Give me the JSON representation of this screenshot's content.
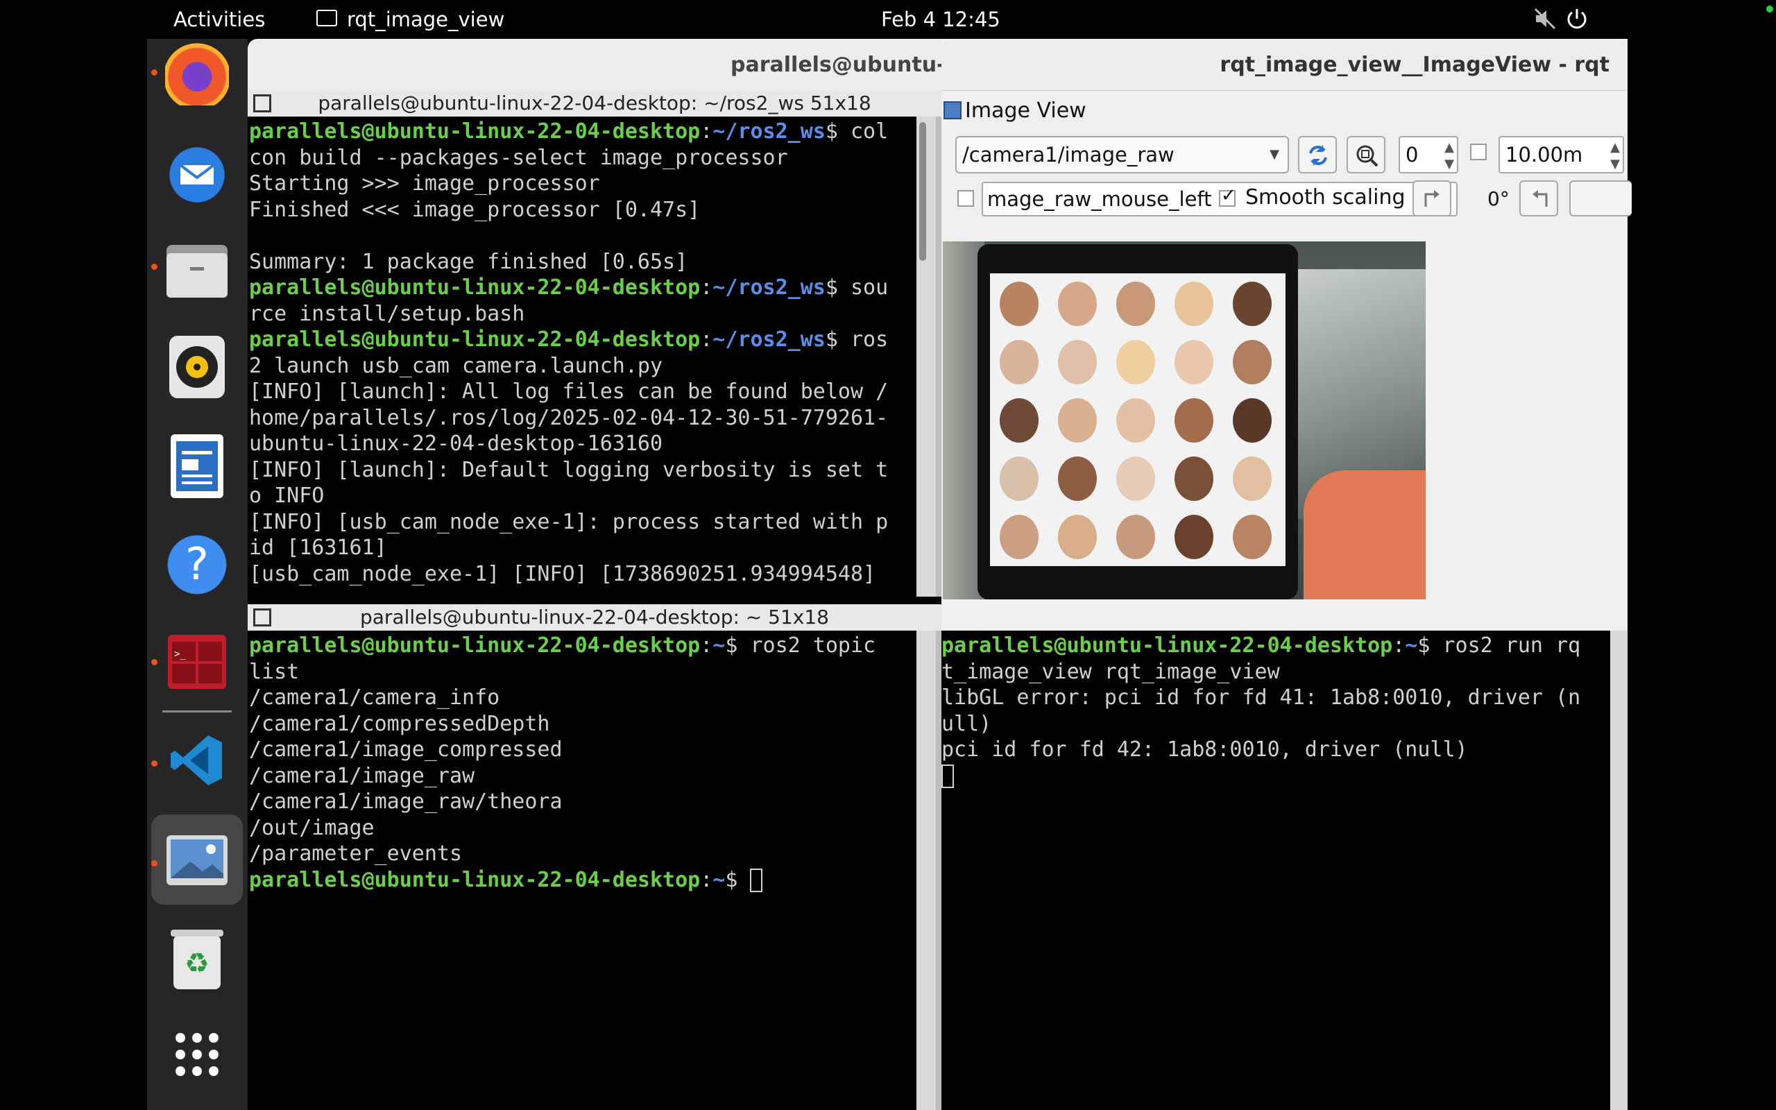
{
  "topbar": {
    "activities": "Activities",
    "app_name": "rqt_image_view",
    "clock": "Feb 4  12:45"
  },
  "dock": {
    "items": [
      "firefox-icon",
      "thunderbird-icon",
      "files-icon",
      "rhythmbox-icon",
      "writer-icon",
      "help-icon",
      "terminal-icon",
      "vscode-icon",
      "image-viewer-icon",
      "trash-icon",
      "show-apps-icon"
    ]
  },
  "terminal_window": {
    "title": "parallels@ubuntu-li"
  },
  "terminal_top": {
    "tab_title": "parallels@ubuntu-linux-22-04-desktop: ~/ros2_ws 51x18",
    "lines": [
      {
        "user": "parallels@ubuntu-linux-22-04-desktop",
        "path": "~/ros2_ws",
        "text": "$ col"
      },
      {
        "text": "con build --packages-select image_processor"
      },
      {
        "text": "Starting >>> image_processor"
      },
      {
        "text": "Finished <<< image_processor [0.47s]"
      },
      {
        "text": ""
      },
      {
        "text": "Summary: 1 package finished [0.65s]"
      },
      {
        "user": "parallels@ubuntu-linux-22-04-desktop",
        "path": "~/ros2_ws",
        "text": "$ sou"
      },
      {
        "text": "rce install/setup.bash"
      },
      {
        "user": "parallels@ubuntu-linux-22-04-desktop",
        "path": "~/ros2_ws",
        "text": "$ ros"
      },
      {
        "text": "2 launch usb_cam camera.launch.py"
      },
      {
        "text": "[INFO] [launch]: All log files can be found below /"
      },
      {
        "text": "home/parallels/.ros/log/2025-02-04-12-30-51-779261-"
      },
      {
        "text": "ubuntu-linux-22-04-desktop-163160"
      },
      {
        "text": "[INFO] [launch]: Default logging verbosity is set t"
      },
      {
        "text": "o INFO"
      },
      {
        "text": "[INFO] [usb_cam_node_exe-1]: process started with p"
      },
      {
        "text": "id [163161]"
      },
      {
        "text": "[usb_cam_node_exe-1] [INFO] [1738690251.934994548]"
      }
    ]
  },
  "terminal_bottom": {
    "tab_title": "parallels@ubuntu-linux-22-04-desktop: ~ 51x18",
    "lines": [
      {
        "user": "parallels@ubuntu-linux-22-04-desktop",
        "path": "~",
        "text": "$ ros2 topic"
      },
      {
        "text": "list"
      },
      {
        "text": "/camera1/camera_info"
      },
      {
        "text": "/camera1/compressedDepth"
      },
      {
        "text": "/camera1/image_compressed"
      },
      {
        "text": "/camera1/image_raw"
      },
      {
        "text": "/camera1/image_raw/theora"
      },
      {
        "text": "/out/image"
      },
      {
        "text": "/parameter_events"
      },
      {
        "user": "parallels@ubuntu-linux-22-04-desktop",
        "path": "~",
        "text": "$ "
      }
    ]
  },
  "terminal_right": {
    "lines": [
      {
        "user": "parallels@ubuntu-linux-22-04-desktop",
        "path": "~",
        "text": "$ ros2 run rq"
      },
      {
        "text": "t_image_view rqt_image_view"
      },
      {
        "text": "libGL error: pci id for fd 41: 1ab8:0010, driver (n"
      },
      {
        "text": "ull)"
      },
      {
        "text": "pci id for fd 42: 1ab8:0010, driver (null)"
      }
    ]
  },
  "rqt": {
    "window_title": "rqt_image_view__ImageView - rqt",
    "plugin_title": "Image View",
    "topic": "/camera1/image_raw",
    "spin_value": "0",
    "max_value": "10.00m",
    "mouse_topic": "mage_raw_mouse_left",
    "smooth_scaling_label": "Smooth scaling",
    "smooth_scaling_checked": true,
    "rotation": "0°"
  }
}
